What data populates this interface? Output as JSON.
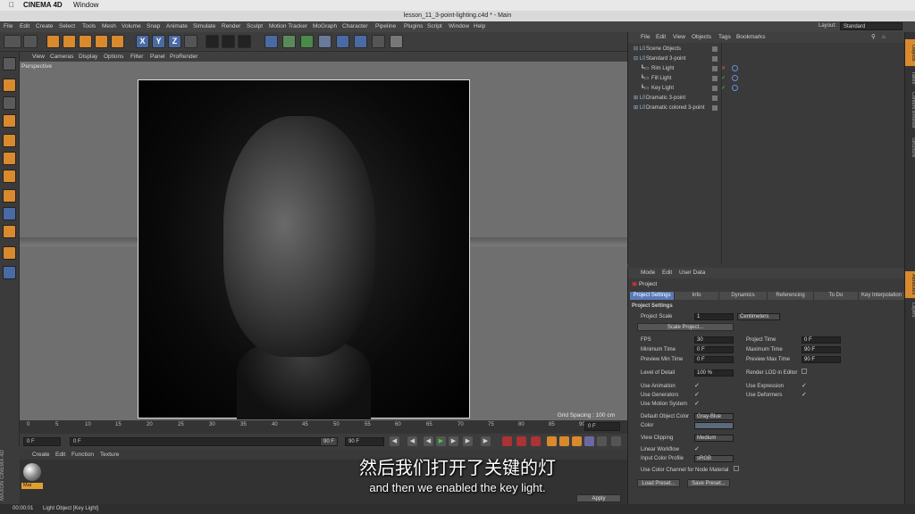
{
  "mac_menu": {
    "app": "CINEMA 4D",
    "window": "Window"
  },
  "window_title": "lesson_11_3-point-lighting.c4d * - Main",
  "main_menu": [
    "File",
    "Edit",
    "Create",
    "Select",
    "Tools",
    "Mesh",
    "Volume",
    "Snap",
    "Animate",
    "Simulate",
    "Render",
    "Sculpt",
    "Motion Tracker",
    "MoGraph",
    "Character",
    "Pipeline",
    "Plugins",
    "Script",
    "Window",
    "Help"
  ],
  "layout": {
    "label": "Layout:",
    "value": "Standard"
  },
  "toolbar": {
    "axis_x": "X",
    "axis_y": "Y",
    "axis_z": "Z"
  },
  "viewport": {
    "menu": [
      "View",
      "Cameras",
      "Display",
      "Options",
      "Filter",
      "Panel",
      "ProRender"
    ],
    "label": "Perspective",
    "grid_spacing": "Grid Spacing : 100 cm"
  },
  "timeline": {
    "ticks": [
      "0",
      "5",
      "10",
      "15",
      "20",
      "25",
      "30",
      "35",
      "40",
      "45",
      "50",
      "55",
      "60",
      "65",
      "70",
      "75",
      "80",
      "85",
      "90"
    ],
    "end_frame": "0 F"
  },
  "transport": {
    "start": "0 F",
    "current": "0 F",
    "max": "90 F",
    "end": "90 F"
  },
  "material": {
    "menu": [
      "Create",
      "Edit",
      "Function",
      "Texture"
    ],
    "name": "Mat"
  },
  "status": {
    "time": "00:00:01",
    "text": "Light Object [Key Light]"
  },
  "maxon": "MAXON CINEMA 4D",
  "subtitles": {
    "zh": "然后我们打开了关键的灯",
    "en": "and then we enabled the key light."
  },
  "objects": {
    "menu": [
      "File",
      "Edit",
      "View",
      "Objects",
      "Tags",
      "Bookmarks"
    ],
    "rows": [
      "Scene Objects",
      "Standard 3-point",
      "Rim Light",
      "Fill Light",
      "Key Light",
      "Dramatic 3-point",
      "Dramatic colored 3-point"
    ]
  },
  "attributes": {
    "menu": [
      "Mode",
      "Edit",
      "User Data"
    ],
    "title": "Project",
    "tabs": [
      "Project Settings",
      "Info",
      "Dynamics",
      "Referencing",
      "To Do",
      "Key Interpolation"
    ],
    "section": "Project Settings",
    "project_scale": {
      "label": "Project Scale",
      "value": "1",
      "unit": "Centimeters"
    },
    "scale_btn": "Scale Project...",
    "fps": {
      "label": "FPS",
      "value": "30"
    },
    "project_time": {
      "label": "Project Time",
      "value": "0 F"
    },
    "min_time": {
      "label": "Minimum Time",
      "value": "0 F"
    },
    "max_time": {
      "label": "Maximum Time",
      "value": "90 F"
    },
    "prev_min": {
      "label": "Preview Min Time",
      "value": "0 F"
    },
    "prev_max": {
      "label": "Preview Max Time",
      "value": "90 F"
    },
    "lod": {
      "label": "Level of Detail",
      "value": "100 %"
    },
    "render_lod": "Render LOD in Editor",
    "use_animation": "Use Animation",
    "use_expression": "Use Expression",
    "use_generators": "Use Generators",
    "use_deformers": "Use Deformers",
    "use_motion": "Use Motion System",
    "default_color": {
      "label": "Default Object Color",
      "value": "Gray-Blue"
    },
    "color": "Color",
    "view_clipping": {
      "label": "View Clipping",
      "value": "Medium"
    },
    "linear_workflow": "Linear Workflow",
    "input_color": {
      "label": "Input Color Profile",
      "value": "sRGB"
    },
    "node_color": "Use Color Channel for Node Material",
    "load_preset": "Load Preset...",
    "save_preset": "Save Preset...",
    "apply": "Apply"
  },
  "side_tabs": [
    "Objects",
    "Takes",
    "Content Browser",
    "Structure"
  ],
  "attr_side_tabs": [
    "Attributes",
    "Layers"
  ]
}
